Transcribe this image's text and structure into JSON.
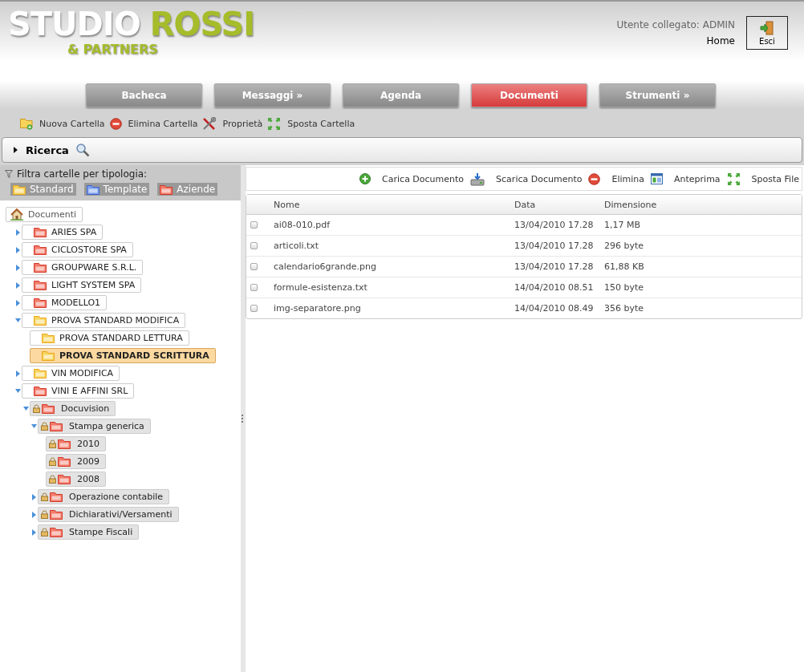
{
  "logo": {
    "title": "STUDIO",
    "accent": "ROSSI",
    "subtitle": "& PARTNERS"
  },
  "user": {
    "label": "Utente collegato: ADMIN",
    "home": "Home",
    "logout": "Esci"
  },
  "nav": [
    {
      "label": "Bacheca",
      "selected": false
    },
    {
      "label": "Messaggi »",
      "selected": false
    },
    {
      "label": "Agenda",
      "selected": false
    },
    {
      "label": "Documenti",
      "selected": true
    },
    {
      "label": "Strumenti »",
      "selected": false
    }
  ],
  "folder_toolbar": [
    {
      "kind": "new-folder",
      "label": "Nuova Cartella"
    },
    {
      "kind": "delete",
      "label": "Elimina Cartella"
    },
    {
      "kind": "tools",
      "label": "Proprietà"
    },
    {
      "kind": "move",
      "label": "Sposta Cartella"
    }
  ],
  "search": {
    "label": "Ricerca"
  },
  "filter": {
    "label": "Filtra cartelle per tipologia:",
    "types": [
      {
        "kind": "standard",
        "label": "Standard"
      },
      {
        "kind": "template",
        "label": "Template"
      },
      {
        "kind": "aziende",
        "label": "Aziende"
      }
    ]
  },
  "tree": {
    "root": "Documenti",
    "children": [
      {
        "label": "ARIES SPA",
        "kind": "aziende",
        "expandable": true,
        "expanded": false,
        "locked": false,
        "selected": false
      },
      {
        "label": "CICLOSTORE SPA",
        "kind": "aziende",
        "expandable": true,
        "expanded": false,
        "locked": false,
        "selected": false
      },
      {
        "label": "GROUPWARE S.R.L.",
        "kind": "aziende",
        "expandable": true,
        "expanded": false,
        "locked": false,
        "selected": false
      },
      {
        "label": "LIGHT SYSTEM SPA",
        "kind": "aziende",
        "expandable": true,
        "expanded": false,
        "locked": false,
        "selected": false
      },
      {
        "label": "MODELLO1",
        "kind": "aziende",
        "expandable": true,
        "expanded": false,
        "locked": false,
        "selected": false
      },
      {
        "label": "PROVA STANDARD MODIFICA",
        "kind": "standard",
        "expandable": true,
        "expanded": true,
        "locked": false,
        "selected": false,
        "children": [
          {
            "label": "PROVA STANDARD LETTURA",
            "kind": "standard",
            "expandable": false,
            "locked": false,
            "selected": false
          },
          {
            "label": "PROVA STANDARD SCRITTURA",
            "kind": "standard",
            "expandable": false,
            "locked": false,
            "selected": true
          }
        ]
      },
      {
        "label": "VIN MODIFICA",
        "kind": "standard",
        "expandable": true,
        "expanded": false,
        "locked": false,
        "selected": false
      },
      {
        "label": "VINI E AFFINI SRL",
        "kind": "aziende",
        "expandable": true,
        "expanded": true,
        "locked": false,
        "selected": false,
        "children": [
          {
            "label": "Docuvision",
            "kind": "aziende",
            "expandable": true,
            "expanded": true,
            "locked": true,
            "selected": false,
            "children": [
              {
                "label": "Stampa generica",
                "kind": "aziende",
                "expandable": true,
                "expanded": true,
                "locked": true,
                "selected": false,
                "children": [
                  {
                    "label": "2010",
                    "kind": "aziende",
                    "expandable": false,
                    "locked": true,
                    "selected": false
                  },
                  {
                    "label": "2009",
                    "kind": "aziende",
                    "expandable": false,
                    "locked": true,
                    "selected": false
                  },
                  {
                    "label": "2008",
                    "kind": "aziende",
                    "expandable": false,
                    "locked": true,
                    "selected": false
                  }
                ]
              },
              {
                "label": "Operazione contabile",
                "kind": "aziende",
                "expandable": true,
                "expanded": false,
                "locked": true,
                "selected": false
              },
              {
                "label": "Dichiarativi/Versamenti",
                "kind": "aziende",
                "expandable": true,
                "expanded": false,
                "locked": true,
                "selected": false
              },
              {
                "label": "Stampe Fiscali",
                "kind": "aziende",
                "expandable": true,
                "expanded": false,
                "locked": true,
                "selected": false
              }
            ]
          }
        ]
      }
    ]
  },
  "file_toolbar": [
    {
      "kind": "add",
      "label": "Carica Documento"
    },
    {
      "kind": "download",
      "label": "Scarica Documento"
    },
    {
      "kind": "delete",
      "label": "Elimina"
    },
    {
      "kind": "preview",
      "label": "Anteprima"
    },
    {
      "kind": "move",
      "label": "Sposta File"
    }
  ],
  "table": {
    "columns": [
      "Nome",
      "Data",
      "Dimensione"
    ],
    "rows": [
      {
        "checked": false,
        "cells": [
          "ai08-010.pdf",
          "13/04/2010 17.28",
          "1,17 MB"
        ]
      },
      {
        "checked": false,
        "cells": [
          "articoli.txt",
          "13/04/2010 17.28",
          "296 byte"
        ]
      },
      {
        "checked": false,
        "cells": [
          "calendario6grande.png",
          "13/04/2010 17.28",
          "61,88 KB"
        ]
      },
      {
        "checked": false,
        "cells": [
          "formule-esistenza.txt",
          "14/04/2010 08.51",
          "150 byte"
        ]
      },
      {
        "checked": false,
        "cells": [
          "img-separatore.png",
          "14/04/2010 08.49",
          "356 byte"
        ]
      }
    ]
  }
}
